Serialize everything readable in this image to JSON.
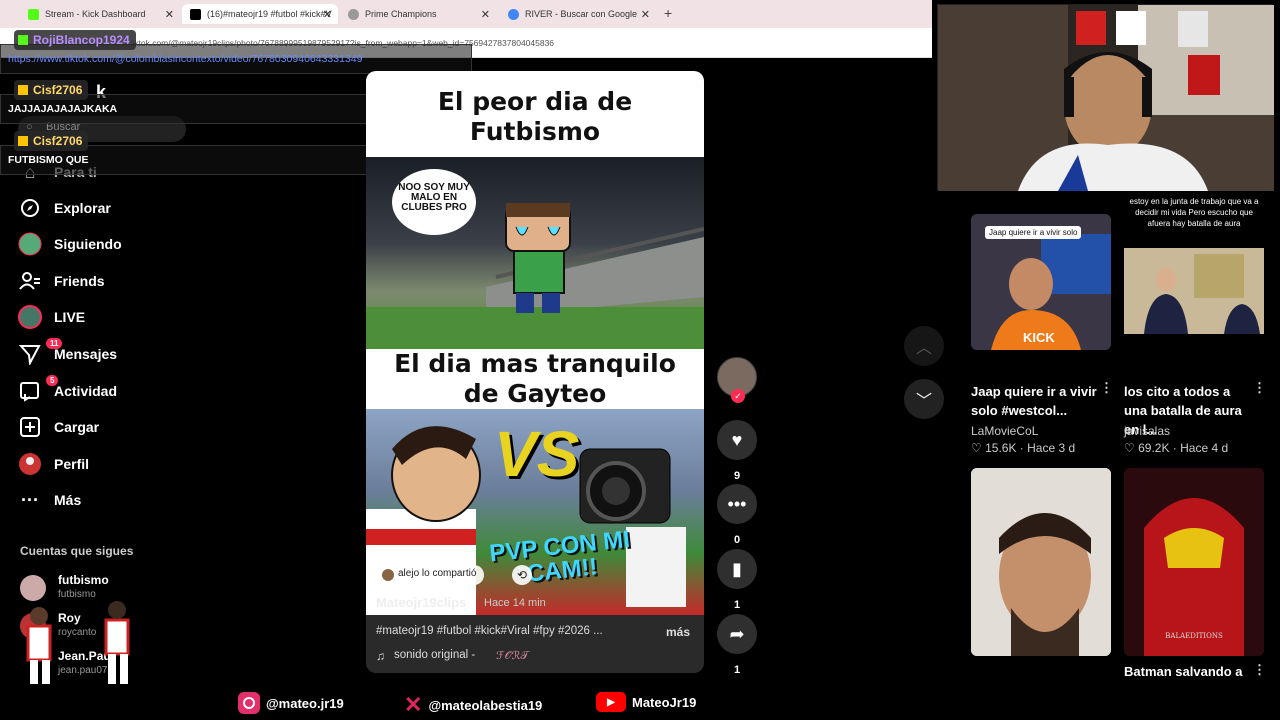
{
  "browser": {
    "tabs": [
      {
        "label": "Stream - Kick Dashboard",
        "icon": "kick-icon",
        "color": "#53fc18"
      },
      {
        "label": "(16)#mateojr19 #futbol #kick#V",
        "icon": "tiktok-icon",
        "color": "#000000"
      },
      {
        "label": "Prime Champions",
        "icon": "globe-icon",
        "color": "#777777"
      },
      {
        "label": "RIVER - Buscar con Google",
        "icon": "google-icon",
        "color": "#4285f4"
      }
    ],
    "new_tab": "+",
    "address": "tiktok.com/@mateojr19clips/photo/7678899951987952917?is_from_webapp=1&web_id=7569427837804045836"
  },
  "chat": {
    "messages": [
      {
        "user": "RojiBlancop1924",
        "text": "https://www.tiktok.com/@colombiasincontexto/video/7678030940643331349",
        "user_color": "#b98cff"
      },
      {
        "user": "Cisf2706",
        "text": "JAJJAJAJAJAJKAKA",
        "user_color": "#ffd86a"
      },
      {
        "user": "Cisf2706",
        "text": "FUTBISMO QUE",
        "user_color": "#ffd86a"
      }
    ]
  },
  "sidebar": {
    "logo_partial": "k",
    "search_placeholder": "Buscar",
    "items": [
      {
        "label": "Para ti",
        "icon": "home-icon"
      },
      {
        "label": "Explorar",
        "icon": "compass-icon"
      },
      {
        "label": "Siguiendo",
        "icon": "following-avatar-icon"
      },
      {
        "label": "Friends",
        "icon": "friends-icon"
      },
      {
        "label": "LIVE",
        "icon": "live-icon"
      },
      {
        "label": "Mensajes",
        "icon": "messages-icon",
        "badge": "11"
      },
      {
        "label": "Actividad",
        "icon": "activity-icon",
        "badge": "5"
      },
      {
        "label": "Cargar",
        "icon": "upload-icon"
      },
      {
        "label": "Perfil",
        "icon": "profile-icon"
      },
      {
        "label": "Más",
        "icon": "more-icon"
      }
    ],
    "following_header": "Cuentas que sigues",
    "following": [
      {
        "name": "futbismo",
        "handle": "futbismo"
      },
      {
        "name": "Roy",
        "handle": "roycanto"
      },
      {
        "name": "Jean.Paul",
        "handle": "jean.pau07"
      }
    ]
  },
  "video": {
    "meme_top": "El peor dia de Futbismo",
    "bubble": "NOO SOY MUY MALO EN CLUBES PRO",
    "meme_bottom": "El dia mas tranquilo de Gayteo",
    "vs_text": "VS",
    "pvp_text": "PVP CON MI CAM!!",
    "shared_by": "alejo lo compartió",
    "author": "Mateojr19clips",
    "time_ago": "Hace 14 min",
    "caption": "#mateojr19 #futbol #kick#Viral #fpy #2026 ...",
    "more": "más",
    "sound": "sonido original -",
    "sound_author": "ℱ𝒪ℛ𝒯"
  },
  "actions": {
    "likes": "9",
    "comments": "0",
    "saves": "1",
    "shares": "1"
  },
  "cards": [
    {
      "overlay": "Jaap quiere ir a vivir solo",
      "brand": "KICK",
      "title": "Jaap quiere ir a vivir solo #westcol...",
      "author": "LaMovieCoL",
      "stats": "15.6K · Hace 3 d"
    },
    {
      "overlay": "estoy en la junta de trabajo que va a decidir mi vida Pero escucho que afuera hay batalla de aura",
      "title": "los cito a todos a una batalla de aura en l...",
      "author": "javisalas",
      "stats": "69.2K · Hace 4 d"
    },
    {
      "title": "",
      "author": "",
      "stats": ""
    },
    {
      "brand": "BALAEDITIONS",
      "title": "Batman salvando a el",
      "author": "",
      "stats": ""
    }
  ],
  "social_bar": [
    {
      "platform": "instagram-icon",
      "handle": "@mateo.jr19",
      "color": "#e1306c"
    },
    {
      "platform": "x-icon",
      "handle": "@mateolabestia19",
      "color": "#e0245e"
    },
    {
      "platform": "youtube-icon",
      "handle": "MateoJr19",
      "color": "#ff0000"
    }
  ]
}
